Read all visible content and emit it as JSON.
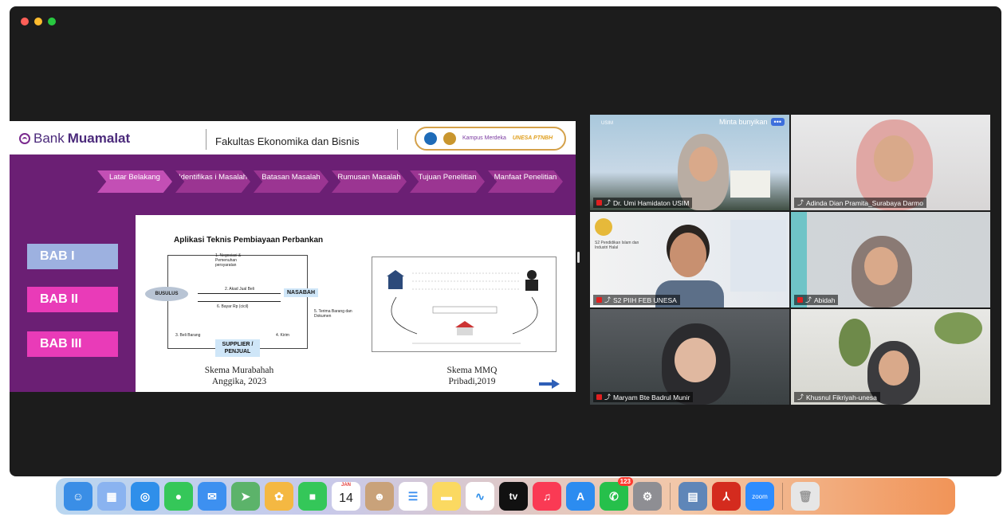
{
  "slide": {
    "bank_prefix": "Bank",
    "bank_name": "Muamalat",
    "faculty": "Fakultas Ekonomika dan Bisnis",
    "partner_kampus": "Kampus Merdeka",
    "partner_unesa": "UNESA PTNBH",
    "nav": [
      {
        "label": "Latar Belakang"
      },
      {
        "label": "Identifikas i Masalah"
      },
      {
        "label": "Batasan Masalah"
      },
      {
        "label": "Rumusan Masalah"
      },
      {
        "label": "Tujuan Penelitian"
      },
      {
        "label": "Manfaat Penelitian"
      }
    ],
    "bab": [
      "BAB I",
      "BAB II",
      "BAB III"
    ],
    "title": "Aplikasi Teknis Pembiayaan Perbankan",
    "diagram": {
      "bank_node": "BUSULUS",
      "nasabah": "NASABAH",
      "supplier": "SUPPLIER / PENJUAL",
      "step1": "1. Negosiasi & Pemenuhan persyaratan",
      "step2": "2. Akad Jual Beli",
      "step3": "6. Bayar Rp (cicil)",
      "step4": "3. Beli Barang",
      "step5": "4. Kirim",
      "step6": "5. Terima Barang dan Dokumen"
    },
    "caption_left_1": "Skema Murabahah",
    "caption_left_2": "Anggika, 2023",
    "caption_right_1": "Skema MMQ",
    "caption_right_2": "Pribadi,2019"
  },
  "gallery": {
    "ask_unmute": "Minta bunyikan",
    "more": "•••",
    "tile1_logo": "USIM",
    "participants": [
      {
        "name": "Dr. Umi Hamidaton USIM"
      },
      {
        "name": "Adinda Dian Pramita_Surabaya Darmo"
      },
      {
        "name": "S2 PIIH FEB UNESA"
      },
      {
        "name": "Abidah"
      },
      {
        "name": "Maryam Bte Badrul Munir"
      },
      {
        "name": "Khusnul Fikriyah-unesa"
      }
    ],
    "tile3_text": "S2 Pendidikan Islam dan Industri Halal"
  },
  "dock": {
    "items": [
      {
        "name": "finder",
        "color": "#3a8ee6"
      },
      {
        "name": "launchpad",
        "color": "#8ab3f0"
      },
      {
        "name": "safari",
        "color": "#2f8fea"
      },
      {
        "name": "messages",
        "color": "#35c759"
      },
      {
        "name": "mail",
        "color": "#3d90f0"
      },
      {
        "name": "maps",
        "color": "#5cb36a"
      },
      {
        "name": "photos",
        "color": "#f4b842"
      },
      {
        "name": "facetime",
        "color": "#34c759"
      },
      {
        "name": "calendar",
        "color": "#ffffff"
      },
      {
        "name": "contacts",
        "color": "#c9a27a"
      },
      {
        "name": "reminders",
        "color": "#ffffff"
      },
      {
        "name": "notes",
        "color": "#fbd961"
      },
      {
        "name": "freeform",
        "color": "#ffffff"
      },
      {
        "name": "apple-tv",
        "color": "#111111"
      },
      {
        "name": "music",
        "color": "#fa3a54"
      },
      {
        "name": "app-store",
        "color": "#2c8cf0"
      },
      {
        "name": "whatsapp",
        "color": "#26c04b"
      },
      {
        "name": "system-settings",
        "color": "#8e8e93"
      },
      {
        "name": "preview",
        "color": "#5f86b8"
      },
      {
        "name": "acrobat",
        "color": "#d42b1e"
      },
      {
        "name": "zoom",
        "color": "#2d8cff"
      },
      {
        "name": "trash",
        "color": "#e6e6e6"
      }
    ],
    "calendar_month": "JAN",
    "calendar_day": "14",
    "tv_label": "tv",
    "zoom_label": "zoom",
    "whatsapp_badge": "123"
  }
}
